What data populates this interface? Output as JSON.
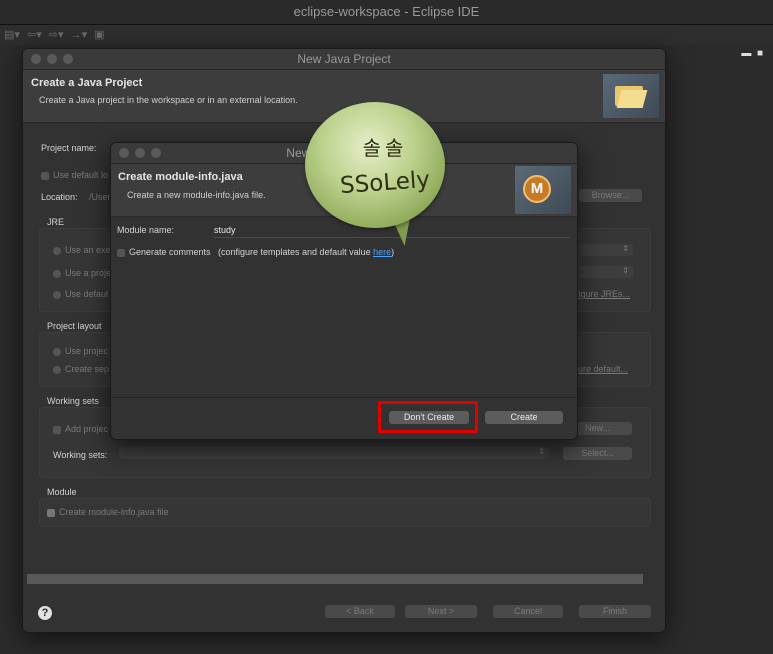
{
  "ide": {
    "title": "eclipse-workspace - Eclipse IDE",
    "toolbar_icons": [
      "new-file-icon",
      "back-icon",
      "forward-icon",
      "navigate-icon",
      "pin-icon"
    ]
  },
  "dialog": {
    "title": "New Java Project",
    "header": "Create a Java Project",
    "description": "Create a Java project in the workspace or in an external location.",
    "project_name_label": "Project name:",
    "use_default_label": "Use default lo",
    "location_label": "Location:",
    "location_value": "/User",
    "browse_button": "Browse...",
    "jre_group": "JRE",
    "jre_option_1": "Use an exe",
    "jre_option_2": "Use a proje",
    "jre_option_3": "Use defaul",
    "configure_jres": "figure JREs...",
    "project_layout_group": "Project layout",
    "layout_option_1": "Use projec",
    "layout_option_2": "Create sep",
    "configure_default": "igure default...",
    "working_sets_group": "Working sets",
    "add_project_label": "Add projec",
    "new_button": "New...",
    "working_sets_label": "Working sets:",
    "select_button": "Select...",
    "module_group": "Module",
    "create_module_info_label": "Create module-info.java file",
    "back_button": "< Back",
    "next_button": "Next >",
    "cancel_button": "Cancel",
    "finish_button": "Finish"
  },
  "module_dialog": {
    "title": "New module-info.java",
    "header": "Create module-info.java",
    "description": "Create a new module-info.java file.",
    "module_name_label": "Module name:",
    "module_name_value": "study",
    "generate_comments_label": "Generate comments",
    "configure_text": "(configure templates and default value ",
    "here_link": "here",
    "close_paren": ")",
    "icon_letter": "M",
    "dont_create_button": "Don't Create",
    "create_button": "Create"
  },
  "watermark": {
    "top_text": "솔솔",
    "bottom_text": "SSoLely"
  }
}
